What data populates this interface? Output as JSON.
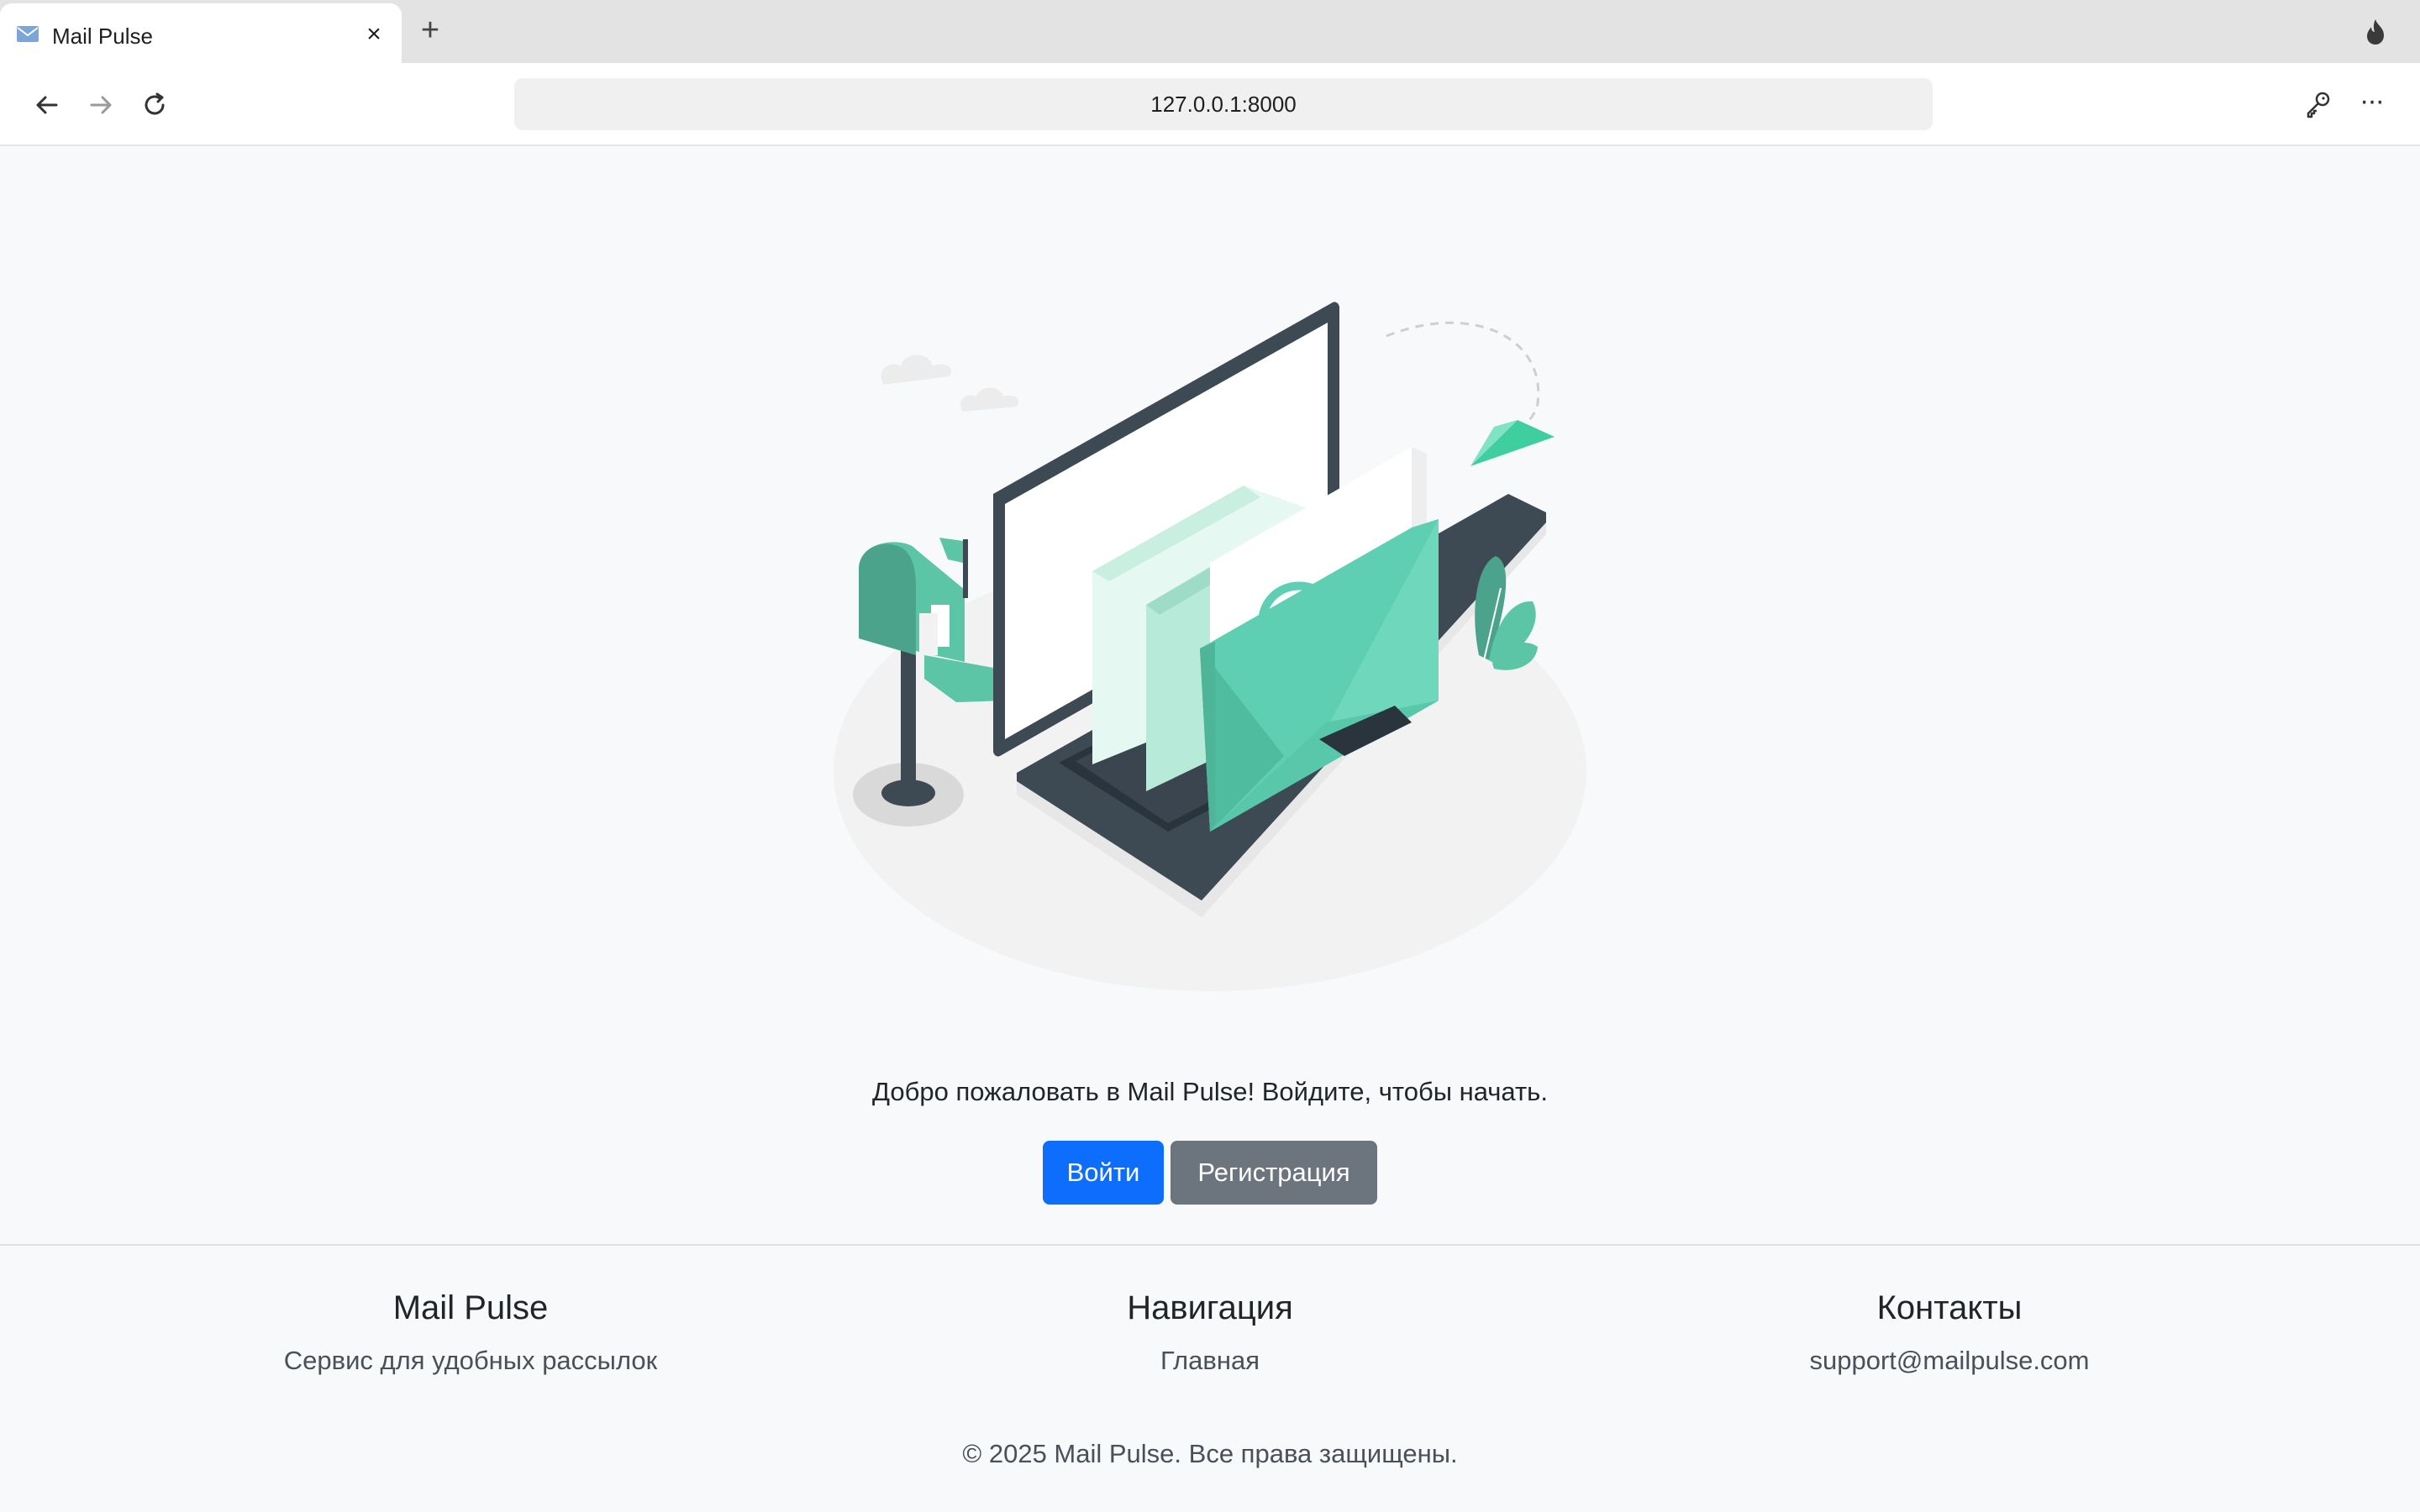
{
  "browser": {
    "tab_title": "Mail Pulse",
    "tab_close": "×",
    "new_tab": "+",
    "url": "127.0.0.1:8000",
    "more": "···"
  },
  "main": {
    "welcome_text": "Добро пожаловать в Mail Pulse! Войдите, чтобы начать.",
    "login_label": "Войти",
    "register_label": "Регистрация"
  },
  "footer": {
    "brand_title": "Mail Pulse",
    "brand_desc": "Сервис для удобных рассылок",
    "nav_title": "Навигация",
    "nav_home": "Главная",
    "contacts_title": "Контакты",
    "contacts_email": "support@mailpulse.com",
    "copyright": "© 2025 Mail Pulse. Все права защищены."
  },
  "colors": {
    "primary": "#0d6efd",
    "secondary": "#6c757d",
    "accent": "#5fcfb3",
    "dark": "#3d4a54"
  }
}
